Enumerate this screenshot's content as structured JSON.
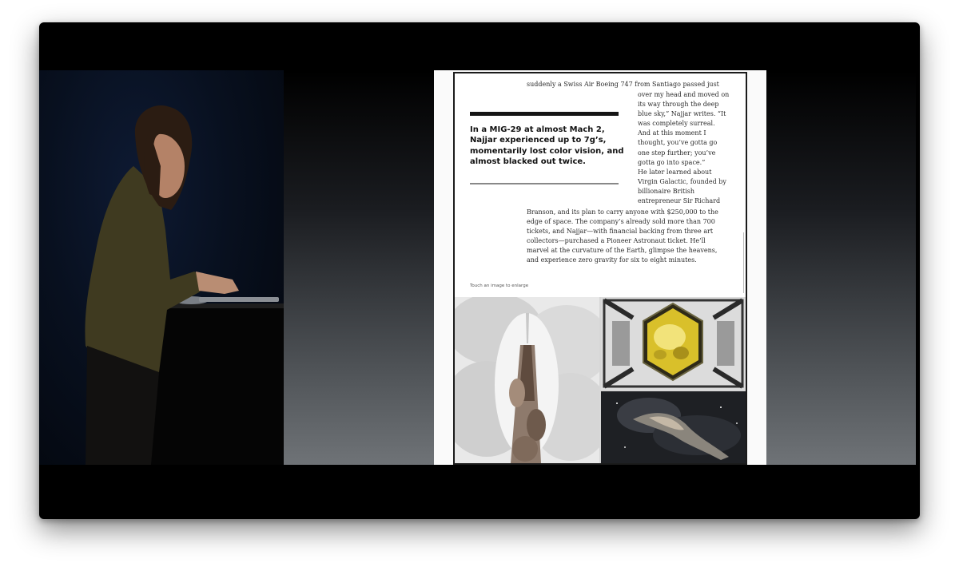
{
  "article": {
    "top_line": "suddenly a Swiss Air Boeing 747 from Santiago passed just",
    "column_lines": [
      "over my head and moved on",
      "its way through the deep",
      "blue sky,” Najjar writes. “It",
      "was completely surreal.",
      "And at this moment I",
      "thought, you’ve gotta go",
      "one step further; you’ve",
      "gotta go into space.”",
      "He later learned about",
      "Virgin Galactic, founded by",
      "billionaire British",
      "entrepreneur Sir Richard"
    ],
    "wide_lines": [
      "Branson, and its plan to carry anyone with $250,000 to the",
      "edge of space. The company’s already sold more than 700",
      "tickets, and Najjar—with financial backing from three art",
      "collectors—purchased a Pioneer Astronaut ticket. He’ll",
      "marvel at the curvature of the Earth, glimpse the heavens,",
      "and experience zero gravity for six to eight minutes."
    ],
    "pull_quote_lines": [
      "In a MIG-29 at almost Mach 2,",
      "Najjar experienced up to 7g’s,",
      "momentarily lost color vision, and",
      "almost blacked out twice."
    ],
    "caption": "Touch an image to enlarge"
  },
  "gallery": {
    "images": [
      {
        "icon": "rocket-launch-smoke-photo"
      },
      {
        "icon": "golden-hexagon-capsule-photo"
      },
      {
        "icon": "nebula-space-photo"
      }
    ]
  },
  "colors": {
    "stage_top": "#000000",
    "stage_bottom": "#6f7377",
    "pull_rule": "#151515",
    "body_text": "#2b2b2b"
  }
}
